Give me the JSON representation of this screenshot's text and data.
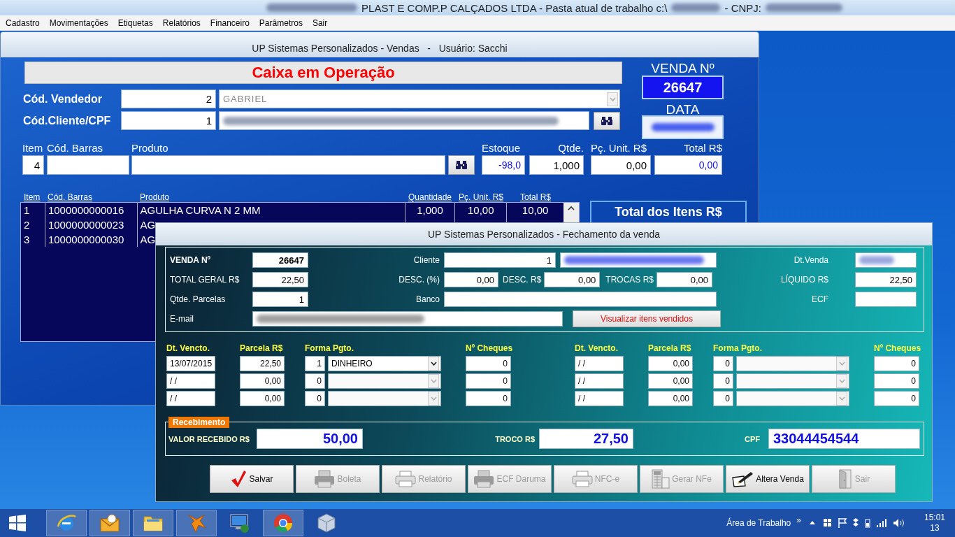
{
  "app_title": {
    "company": "PLAST E COMP.P CALÇADOS LTDA - Pasta atual de trabalho c:\\",
    "cnpj_label": "- CNPJ:"
  },
  "menu": [
    "Cadastro",
    "Movimentações",
    "Etiquetas",
    "Relatórios",
    "Financeiro",
    "Parâmetros",
    "Sair"
  ],
  "sales_window": {
    "title": "UP Sistemas Personalizados - Vendas   -   Usuário: Sacchi",
    "banner": "Caixa em Operação",
    "sale_number_label": "VENDA Nº",
    "sale_number": "26647",
    "date_label": "DATA",
    "seller": {
      "label": "Cód. Vendedor",
      "code": "2",
      "name": "GABRIEL"
    },
    "client": {
      "label": "Cód.Cliente/CPF",
      "code": "1"
    },
    "entry": [
      {
        "kind": "field",
        "label": "Item",
        "value": "4"
      },
      {
        "kind": "field",
        "label": "Cód. Barras"
      },
      {
        "kind": "field",
        "label": "Produto"
      },
      {
        "kind": "button"
      },
      {
        "kind": "readonly",
        "label": "Estoque",
        "value": "-98,0"
      },
      {
        "kind": "field",
        "label": "Qtde.",
        "value": "1,000"
      },
      {
        "kind": "field",
        "label": "Pç. Unit. R$",
        "value": "0,00"
      },
      {
        "kind": "readonly",
        "label": "Total R$",
        "value": "0,00"
      }
    ],
    "items_table": {
      "columns": [
        "Item",
        "Cód. Barras",
        "Produto",
        "Quantidade",
        "Pç. Unit. R$",
        "Total R$"
      ],
      "rows": [
        {
          "cells": [
            "1",
            "1000000000016",
            "AGULHA CURVA N 2 MM",
            "1,000",
            "10,00",
            "10,00"
          ]
        },
        {
          "cells": [
            "2",
            "1000000000023",
            "AG"
          ]
        },
        {
          "cells": [
            "3",
            "1000000000030",
            "AG"
          ]
        }
      ]
    },
    "total_panel_label": "Total dos Itens R$"
  },
  "closing_dialog": {
    "title": "UP Sistemas Personalizados - Fechamento da venda",
    "sale_number": {
      "label": "VENDA Nº",
      "value": "26647"
    },
    "client": {
      "label": "Cliente",
      "value": "1"
    },
    "sale_date": {
      "label": "Dt.Venda"
    },
    "total": {
      "label": "TOTAL GERAL R$",
      "value": "22,50"
    },
    "discount_pct": {
      "label": "DESC. (%)",
      "value": "0,00"
    },
    "discount": {
      "label": "DESC. R$",
      "value": "0,00"
    },
    "trade_ins": {
      "label": "TROCAS R$",
      "value": "0,00"
    },
    "net": {
      "label": "LÍQUIDO R$",
      "value": "22,50"
    },
    "installment_count": {
      "label": "Qtde. Parcelas",
      "value": "1"
    },
    "bank": {
      "label": "Banco"
    },
    "ecf": {
      "label": "ECF"
    },
    "email": {
      "label": "E-mail"
    },
    "view_items_button": "Visualizar itens vendidos",
    "installment_groups": [
      {
        "headers": [
          "Dt. Vencto.",
          "Parcela R$",
          "Forma Pgto.",
          "Nº Cheques"
        ],
        "rows": [
          {
            "due_date": "13/07/2015",
            "amount": "22,50",
            "method_code": "1",
            "method": "DINHEIRO",
            "cheques": "0",
            "disabled": false
          },
          {
            "due_date": "/ /",
            "amount": "0,00",
            "method_code": "0",
            "cheques": "0",
            "disabled": true
          },
          {
            "due_date": "/ /",
            "amount": "0,00",
            "method_code": "0",
            "cheques": "0",
            "disabled": true
          }
        ]
      },
      {
        "headers": [
          "Dt. Vencto.",
          "Parcela R$",
          "Forma Pgto.",
          "Nº Cheques"
        ],
        "rows": [
          {
            "due_date": "/ /",
            "amount": "0,00",
            "method_code": "0",
            "cheques": "0",
            "disabled": true
          },
          {
            "due_date": "/ /",
            "amount": "0,00",
            "method_code": "0",
            "cheques": "0",
            "disabled": true
          },
          {
            "due_date": "/ /",
            "amount": "0,00",
            "method_code": "0",
            "cheques": "0",
            "disabled": true
          }
        ]
      }
    ],
    "receipt": {
      "legend": "Recebimento",
      "received_label": "VALOR RECEBIDO R$",
      "received": "50,00",
      "change_label": "TROCO R$",
      "change": "27,50",
      "cpf_label": "CPF",
      "cpf": "33044454544"
    },
    "buttons": [
      {
        "kind": "save",
        "label": "Salvar",
        "disabled": false
      },
      {
        "kind": "printer",
        "label": "Boleta",
        "disabled": true
      },
      {
        "kind": "report",
        "label": "Relatório",
        "disabled": true
      },
      {
        "kind": "printer",
        "label": "ECF Daruma",
        "disabled": true
      },
      {
        "kind": "report",
        "label": "NFC-e",
        "disabled": true
      },
      {
        "kind": "calculator",
        "label": "Gerar NFe",
        "disabled": true
      },
      {
        "kind": "edit",
        "label": "Altera Venda",
        "disabled": false
      },
      {
        "kind": "exit",
        "label": "Sair",
        "disabled": true
      }
    ]
  },
  "taskbar": {
    "apps": [
      {
        "kind": "browser",
        "active": true
      },
      {
        "kind": "mail",
        "active": true
      },
      {
        "kind": "folder",
        "active": true
      },
      {
        "kind": "fox",
        "active": true
      },
      {
        "kind": "remote",
        "active": false
      },
      {
        "kind": "chrome",
        "active": true
      },
      {
        "kind": "cube",
        "active": false
      }
    ],
    "desktop_label": "Área de Trabalho",
    "chevron": "»",
    "time": "15:01",
    "date": "13"
  }
}
